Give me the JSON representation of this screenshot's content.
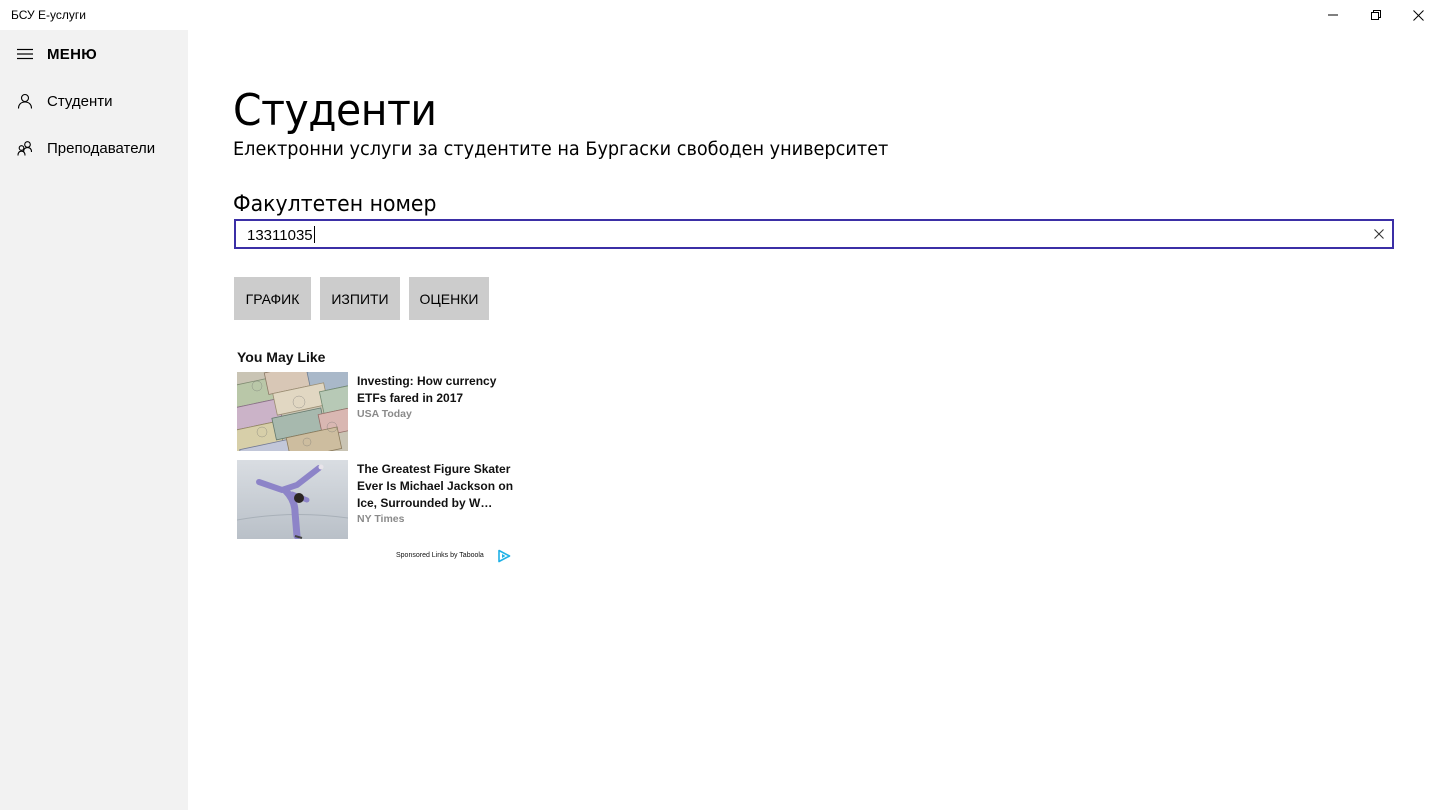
{
  "app": {
    "title": "БСУ Е-услуги"
  },
  "window_controls": {
    "minimize_icon": "minimize-icon",
    "restore_icon": "restore-icon",
    "close_icon": "close-icon"
  },
  "sidebar": {
    "menu_label": "МЕНЮ",
    "items": [
      {
        "label": "Студенти",
        "icon": "person-icon"
      },
      {
        "label": "Преподаватели",
        "icon": "people-icon"
      }
    ]
  },
  "main": {
    "title": "Студенти",
    "subtitle": "Електронни услуги за студентите на Бургаски свободен университет",
    "field_label": "Факултетен номер",
    "field_value": "13311035",
    "buttons": {
      "schedule": "ГРАФИК",
      "exams": "ИЗПИТИ",
      "grades": "ОЦЕНКИ"
    }
  },
  "ads": {
    "heading": "You May Like",
    "items": [
      {
        "title": "Investing: How currency ETFs fared in 2017",
        "source": "USA Today"
      },
      {
        "title": "The Greatest Figure Skater Ever Is Michael Jackson on Ice, Surrounded by W…",
        "source": "NY Times"
      }
    ],
    "sponsored_text": "Sponsored Links by Taboola"
  },
  "colors": {
    "sidebar_bg": "#f2f2f2",
    "input_border": "#3b2fa6",
    "button_bg": "#cccccc",
    "source_text": "#8a8a8a"
  }
}
